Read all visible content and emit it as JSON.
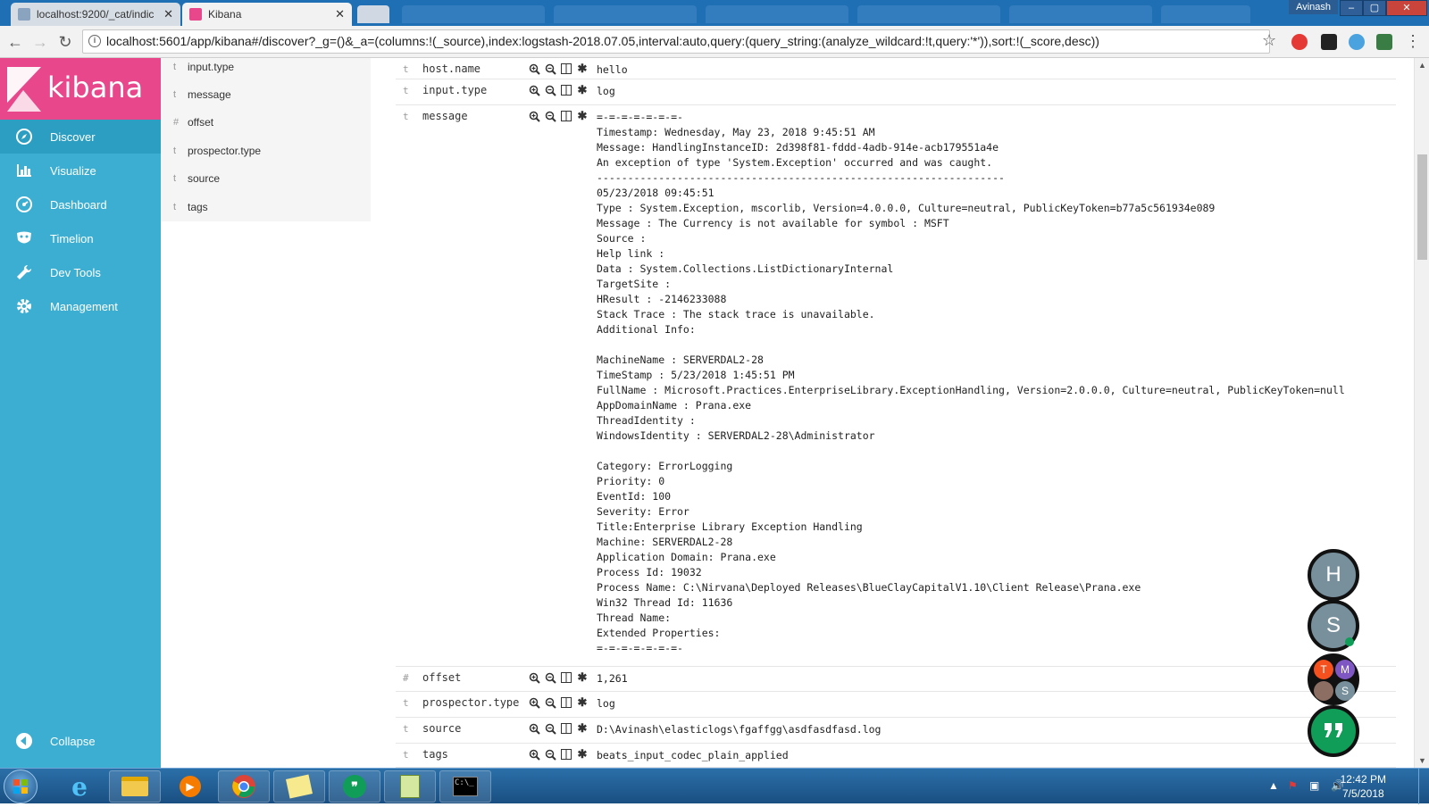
{
  "browser": {
    "tabs": [
      {
        "title": "localhost:9200/_cat/indic",
        "active": false
      },
      {
        "title": "Kibana",
        "active": true
      }
    ],
    "window_user": "Avinash",
    "url": "localhost:5601/app/kibana#/discover?_g=()&_a=(columns:!(_source),index:logstash-2018.07.05,interval:auto,query:(query_string:(analyze_wildcard:!t,query:'*')),sort:!(_score,desc))"
  },
  "kibana": {
    "logo_text": "kibana",
    "nav": [
      {
        "label": "Discover",
        "icon": "compass-icon",
        "active": true
      },
      {
        "label": "Visualize",
        "icon": "bar-chart-icon",
        "active": false
      },
      {
        "label": "Dashboard",
        "icon": "dashboard-icon",
        "active": false
      },
      {
        "label": "Timelion",
        "icon": "timelion-mask-icon",
        "active": false
      },
      {
        "label": "Dev Tools",
        "icon": "wrench-icon",
        "active": false
      },
      {
        "label": "Management",
        "icon": "gear-icon",
        "active": false
      }
    ],
    "collapse_label": "Collapse"
  },
  "field_list": [
    {
      "type": "t",
      "name": "input.type"
    },
    {
      "type": "t",
      "name": "message"
    },
    {
      "type": "#",
      "name": "offset"
    },
    {
      "type": "t",
      "name": "prospector.type"
    },
    {
      "type": "t",
      "name": "source"
    },
    {
      "type": "t",
      "name": "tags"
    }
  ],
  "document": {
    "rows": [
      {
        "type": "t",
        "key": "host.name",
        "value": "hello"
      },
      {
        "type": "t",
        "key": "input.type",
        "value": "log"
      },
      {
        "type": "t",
        "key": "message",
        "value": "=-=-=-=-=-=-=-\nTimestamp: Wednesday, May 23, 2018 9:45:51 AM\nMessage: HandlingInstanceID: 2d398f81-fddd-4adb-914e-acb179551a4e\nAn exception of type 'System.Exception' occurred and was caught.\n------------------------------------------------------------------\n05/23/2018 09:45:51\nType : System.Exception, mscorlib, Version=4.0.0.0, Culture=neutral, PublicKeyToken=b77a5c561934e089\nMessage : The Currency is not available for symbol : MSFT\nSource :\nHelp link :\nData : System.Collections.ListDictionaryInternal\nTargetSite :\nHResult : -2146233088\nStack Trace : The stack trace is unavailable.\nAdditional Info:\n\nMachineName : SERVERDAL2-28\nTimeStamp : 5/23/2018 1:45:51 PM\nFullName : Microsoft.Practices.EnterpriseLibrary.ExceptionHandling, Version=2.0.0.0, Culture=neutral, PublicKeyToken=null\nAppDomainName : Prana.exe\nThreadIdentity :\nWindowsIdentity : SERVERDAL2-28\\Administrator\n\nCategory: ErrorLogging\nPriority: 0\nEventId: 100\nSeverity: Error\nTitle:Enterprise Library Exception Handling\nMachine: SERVERDAL2-28\nApplication Domain: Prana.exe\nProcess Id: 19032\nProcess Name: C:\\Nirvana\\Deployed Releases\\BlueClayCapitalV1.10\\Client Release\\Prana.exe\nWin32 Thread Id: 11636\nThread Name:\nExtended Properties:\n=-=-=-=-=-=-=-"
      },
      {
        "type": "#",
        "key": "offset",
        "value": "1,261"
      },
      {
        "type": "t",
        "key": "prospector.type",
        "value": "log"
      },
      {
        "type": "t",
        "key": "source",
        "value": "D:\\Avinash\\elasticlogs\\fgaffgg\\asdfasdfasd.log"
      },
      {
        "type": "t",
        "key": "tags",
        "value": "beats_input_codec_plain_applied"
      }
    ]
  },
  "hangouts": {
    "contacts": [
      {
        "initial": "H",
        "color": "#78909c"
      },
      {
        "initial": "S",
        "color": "#78909c"
      }
    ],
    "group": [
      "T",
      "M",
      "S"
    ]
  },
  "taskbar": {
    "time": "12:42 PM",
    "date": "7/5/2018"
  }
}
